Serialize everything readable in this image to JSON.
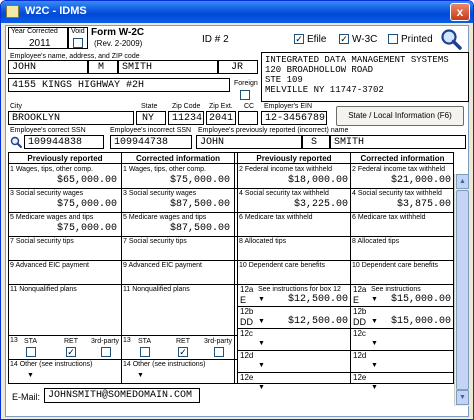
{
  "window": {
    "title": "W2C - IDMS",
    "close_label": "x"
  },
  "top": {
    "year_label": "Year Corrected",
    "year": "2011",
    "void_label": "Void",
    "form_title": "Form W-2C",
    "form_rev": "(Rev. 2-2009)",
    "id_label": "ID # 2",
    "efile_label": "Efile",
    "w3c_label": "W-3C",
    "printed_label": "Printed",
    "efile_checked": "✓",
    "w3c_checked": "✓"
  },
  "employee": {
    "name_label": "Employee's name, address, and ZIP code",
    "first": "JOHN",
    "mi": "M",
    "last": "SMITH",
    "suffix": "JR",
    "address": "4155 KINGS HIGHWAY #2H",
    "foreign_label": "Foreign",
    "city_label": "City",
    "city": "BROOKLYN",
    "state_label": "State",
    "state": "NY",
    "zip_label": "Zip Code",
    "zip": "11234",
    "zipext_label": "Zip Ext.",
    "zipext": "2041",
    "cc_label": "CC",
    "correct_ssn_label": "Employee's correct SSN",
    "correct_ssn": "109944838",
    "incorrect_ssn_label": "Employee's incorrect SSN",
    "incorrect_ssn": "109944738",
    "prev_name_label": "Employee's previously reported (incorrect) name",
    "prev_first": "JOHN",
    "prev_mi": "S",
    "prev_last": "SMITH"
  },
  "employer": {
    "line1": "INTEGRATED DATA MANAGEMENT SYSTEMS",
    "line2": "120 BROADHOLLOW ROAD",
    "line3": "STE 109",
    "line4": "MELVILLE NY 11747-3702",
    "ein_label": "Employer's EIN",
    "ein": "12-3456789",
    "state_local_button": "State / Local Information (F6)"
  },
  "headers": {
    "prev": "Previously reported",
    "corr": "Corrected information",
    "prev2": "Previously reported",
    "corr2": "Corrected information"
  },
  "left_boxes": [
    {
      "label": "1  Wages, tips, other comp.",
      "prev": "$65,000.00",
      "corr_label": "1  Wages, tips, other comp.",
      "corr": "$75,000.00"
    },
    {
      "label": "3  Social security wages",
      "prev": "$75,000.00",
      "corr_label": "3  Social security wages",
      "corr": "$87,500.00"
    },
    {
      "label": "5  Medicare wages and tips",
      "prev": "$75,000.00",
      "corr_label": "5  Medicare wages and tips",
      "corr": "$87,500.00"
    },
    {
      "label": "7  Social security tips",
      "prev": "",
      "corr_label": "7  Social security tips",
      "corr": ""
    },
    {
      "label": "9  Advanced EIC payment",
      "prev": "",
      "corr_label": "9  Advanced EIC payment",
      "corr": ""
    },
    {
      "label": "11  Nonqualified plans",
      "prev": "",
      "corr_label": "11  Nonqualified plans",
      "corr": ""
    }
  ],
  "box13": {
    "label": "13",
    "sta": "STA",
    "ret": "RET",
    "third": "3rd-party",
    "ret_checked": "✓"
  },
  "box14": {
    "label": "14  Other (see instructions)"
  },
  "right_boxes": [
    {
      "label": "2  Federal income tax withheld",
      "prev": "$18,000.00",
      "corr_label": "2  Federal income tax withheld",
      "corr": "$21,000.00"
    },
    {
      "label": "4  Social security tax withheld",
      "prev": "$3,225.00",
      "corr_label": "4  Social security tax withheld",
      "corr": "$3,875.00"
    },
    {
      "label": "6  Medicare tax withheld",
      "prev": "",
      "corr_label": "6  Medicare tax withheld",
      "corr": ""
    },
    {
      "label": "8  Allocated tips",
      "prev": "",
      "corr_label": "8  Allocated tips",
      "corr": ""
    },
    {
      "label": "10  Dependent care benefits",
      "prev": "",
      "corr_label": "10  Dependent care benefits",
      "corr": ""
    }
  ],
  "box12": [
    {
      "label": "12a",
      "label_text": "See instructions for box 12",
      "code": "E",
      "prev": "$12,500.00",
      "corr_label": "12a",
      "corr_text": "See instructions",
      "corr_code": "E",
      "corr": "$15,000.00"
    },
    {
      "label": "12b",
      "code": "DD",
      "prev": "$12,500.00",
      "corr_label": "12b",
      "corr_code": "DD",
      "corr": "$15,000.00"
    },
    {
      "label": "12c",
      "code": "",
      "prev": "",
      "corr_label": "12c",
      "corr_code": "",
      "corr": ""
    },
    {
      "label": "12d",
      "code": "",
      "prev": "",
      "corr_label": "12d",
      "corr_code": "",
      "corr": ""
    },
    {
      "label": "12e",
      "code": "",
      "prev": "",
      "corr_label": "12e",
      "corr_code": "",
      "corr": ""
    }
  ],
  "email": {
    "label": "E-Mail:",
    "value": "JOHNSMITH@SOMEDOMAIN.COM"
  },
  "icons": {
    "search": "search-icon",
    "magnifier": "magnifier-icon"
  }
}
